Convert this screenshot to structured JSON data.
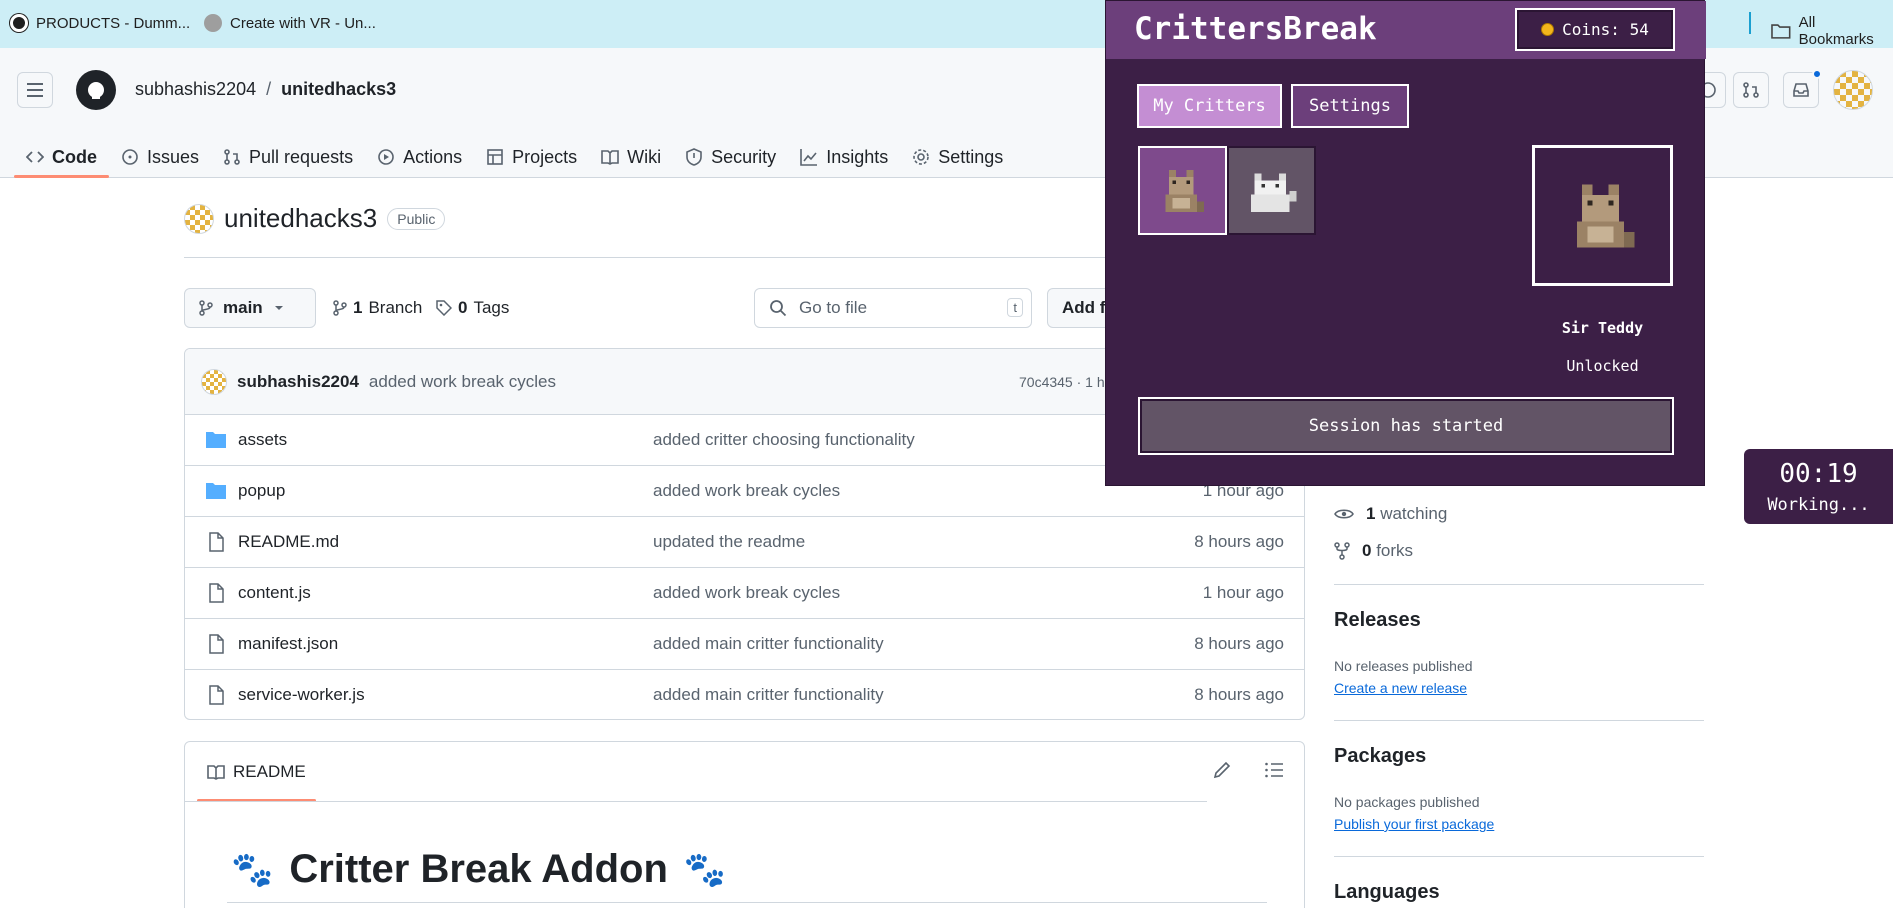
{
  "browser": {
    "bookmarks": [
      {
        "label": "PRODUCTS - Dumm..."
      },
      {
        "label": "Create with VR - Un..."
      }
    ],
    "all_bookmarks": "All Bookmarks"
  },
  "github": {
    "owner": "subhashis2204",
    "separator": "/",
    "repo": "unitedhacks3",
    "tabs": [
      {
        "label": "Code",
        "icon": "code-icon"
      },
      {
        "label": "Issues",
        "icon": "issue-icon"
      },
      {
        "label": "Pull requests",
        "icon": "pull-request-icon"
      },
      {
        "label": "Actions",
        "icon": "play-icon"
      },
      {
        "label": "Projects",
        "icon": "table-icon"
      },
      {
        "label": "Wiki",
        "icon": "book-icon"
      },
      {
        "label": "Security",
        "icon": "shield-icon"
      },
      {
        "label": "Insights",
        "icon": "graph-icon"
      },
      {
        "label": "Settings",
        "icon": "gear-icon"
      }
    ],
    "visibility": "Public",
    "branch": "main",
    "branches_count": "1",
    "branches_label": "Branch",
    "tags_count": "0",
    "tags_label": "Tags",
    "go_to_file_placeholder": "Go to file",
    "go_to_file_key": "t",
    "add_file_label": "Add f",
    "commit": {
      "author": "subhashis2204",
      "message": "added work break cycles",
      "sha_time": "70c4345 · 1 h"
    },
    "files": [
      {
        "type": "folder",
        "name": "assets",
        "message": "added critter choosing functionality",
        "time": ""
      },
      {
        "type": "folder",
        "name": "popup",
        "message": "added work break cycles",
        "time": "1 hour ago"
      },
      {
        "type": "file",
        "name": "README.md",
        "message": "updated the readme",
        "time": "8 hours ago"
      },
      {
        "type": "file",
        "name": "content.js",
        "message": "added work break cycles",
        "time": "1 hour ago"
      },
      {
        "type": "file",
        "name": "manifest.json",
        "message": "added main critter functionality",
        "time": "8 hours ago"
      },
      {
        "type": "file",
        "name": "service-worker.js",
        "message": "added main critter functionality",
        "time": "8 hours ago"
      }
    ],
    "readme": {
      "tab_label": "README",
      "heading": "Critter Break Addon",
      "heading_emoji": "🐾"
    },
    "sidebar": {
      "watching_count": "1",
      "watching_label": "watching",
      "forks_count": "0",
      "forks_label": "forks",
      "releases_title": "Releases",
      "releases_text": "No releases published",
      "releases_link": "Create a new release",
      "packages_title": "Packages",
      "packages_text": "No packages published",
      "packages_link": "Publish your first package",
      "languages_title": "Languages"
    }
  },
  "critters": {
    "title": "CrittersBreak",
    "coins_label": "Coins: 54",
    "tab_my_critters": "My Critters",
    "tab_settings": "Settings",
    "selected_name": "Sir Teddy",
    "selected_status": "Unlocked",
    "session_button": "Session has started",
    "colors": {
      "panel": "#3c1f46",
      "header": "#6c3f7b",
      "accent": "#c48ed3"
    }
  },
  "timer": {
    "time": "00:19",
    "state": "Working..."
  }
}
